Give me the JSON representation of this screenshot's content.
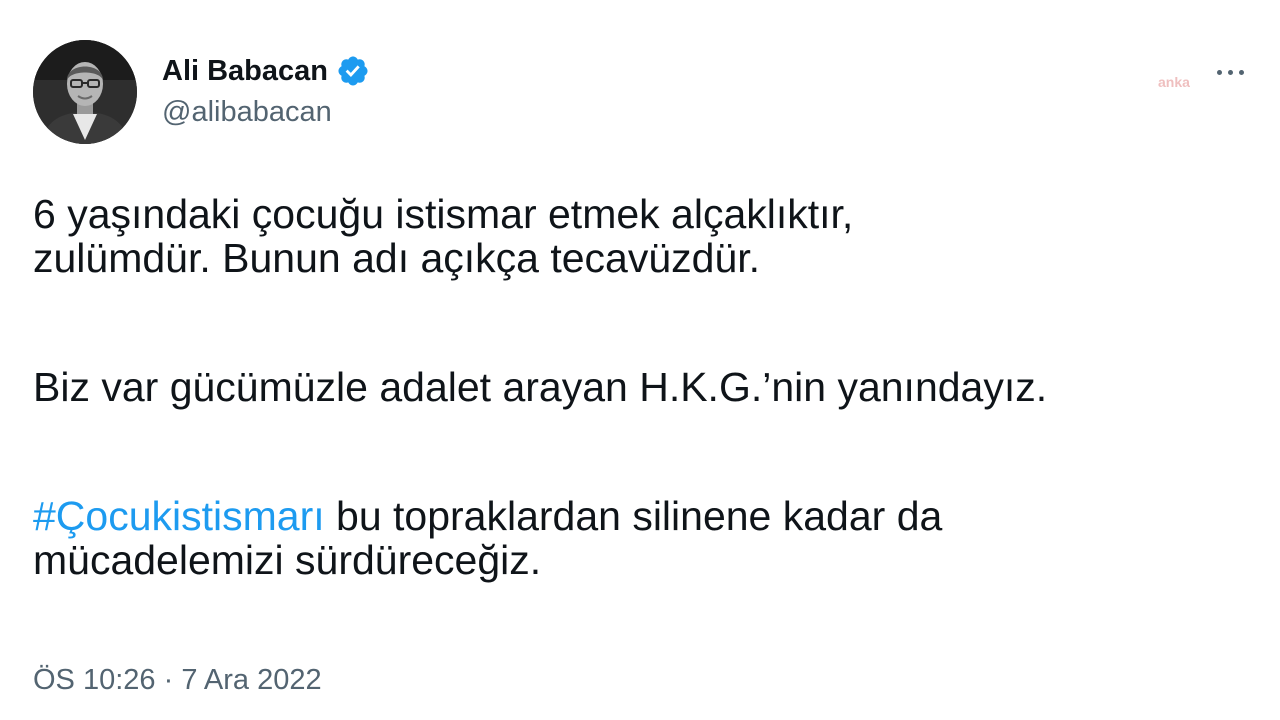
{
  "author": {
    "display_name": "Ali Babacan",
    "handle": "@alibabacan",
    "verified_icon": "verified-badge-icon",
    "avatar_icon": "profile-photo"
  },
  "watermark": "anka",
  "tweet": {
    "paragraph1_line1": "6 yaşındaki çocuğu istismar etmek alçaklıktır,",
    "paragraph1_line2": "zulümdür. Bunun adı açıkça tecavüzdür.",
    "paragraph2": "Biz var gücümüzle adalet arayan H.K.G.’nin yanındayız.",
    "hashtag": "#Çocukistismarı",
    "paragraph3_rest": " bu topraklardan silinene kadar da",
    "paragraph3_line2": "mücadelemizi sürdüreceğiz."
  },
  "timestamp": {
    "time": "ÖS 10:26",
    "separator": " · ",
    "date": "7 Ara 2022"
  },
  "colors": {
    "accent": "#1d9bf0",
    "text": "#0f1419",
    "secondary": "#536471"
  }
}
